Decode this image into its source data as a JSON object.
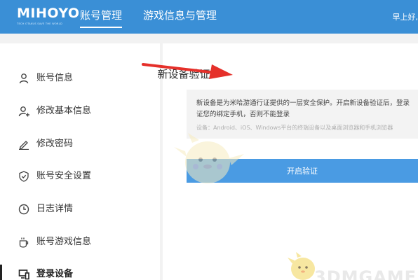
{
  "header": {
    "logo": "MIHOYO",
    "logo_slogan": "TECH OTAKUS SAVE THE WORLD",
    "tabs": [
      {
        "label": "账号管理",
        "active": true
      },
      {
        "label": "游戏信息与管理",
        "active": false
      }
    ],
    "greeting": "早上好,",
    "bg_color": "#3a8fd6"
  },
  "sidebar": {
    "items": [
      {
        "label": "账号信息",
        "icon": "user-icon",
        "active": false
      },
      {
        "label": "修改基本信息",
        "icon": "user-edit-icon",
        "active": false
      },
      {
        "label": "修改密码",
        "icon": "pencil-icon",
        "active": false
      },
      {
        "label": "账号安全设置",
        "icon": "shield-icon",
        "active": false
      },
      {
        "label": "日志详情",
        "icon": "clock-icon",
        "active": false
      },
      {
        "label": "账号游戏信息",
        "icon": "cup-icon",
        "active": false
      },
      {
        "label": "登录设备",
        "icon": "device-icon",
        "active": true
      }
    ]
  },
  "main": {
    "title": "新设备验证",
    "description": "新设备是为米哈游通行证提供的一层安全保护。开启新设备验证后，登录  证您的绑定手机，否则不能登录",
    "note": "设备：Android、iOS、Windows平台的终端设备以及桌面浏览器和手机浏览器",
    "button_label": "开启验证",
    "button_color": "#4a9be3"
  },
  "watermark": "3DMGAME"
}
